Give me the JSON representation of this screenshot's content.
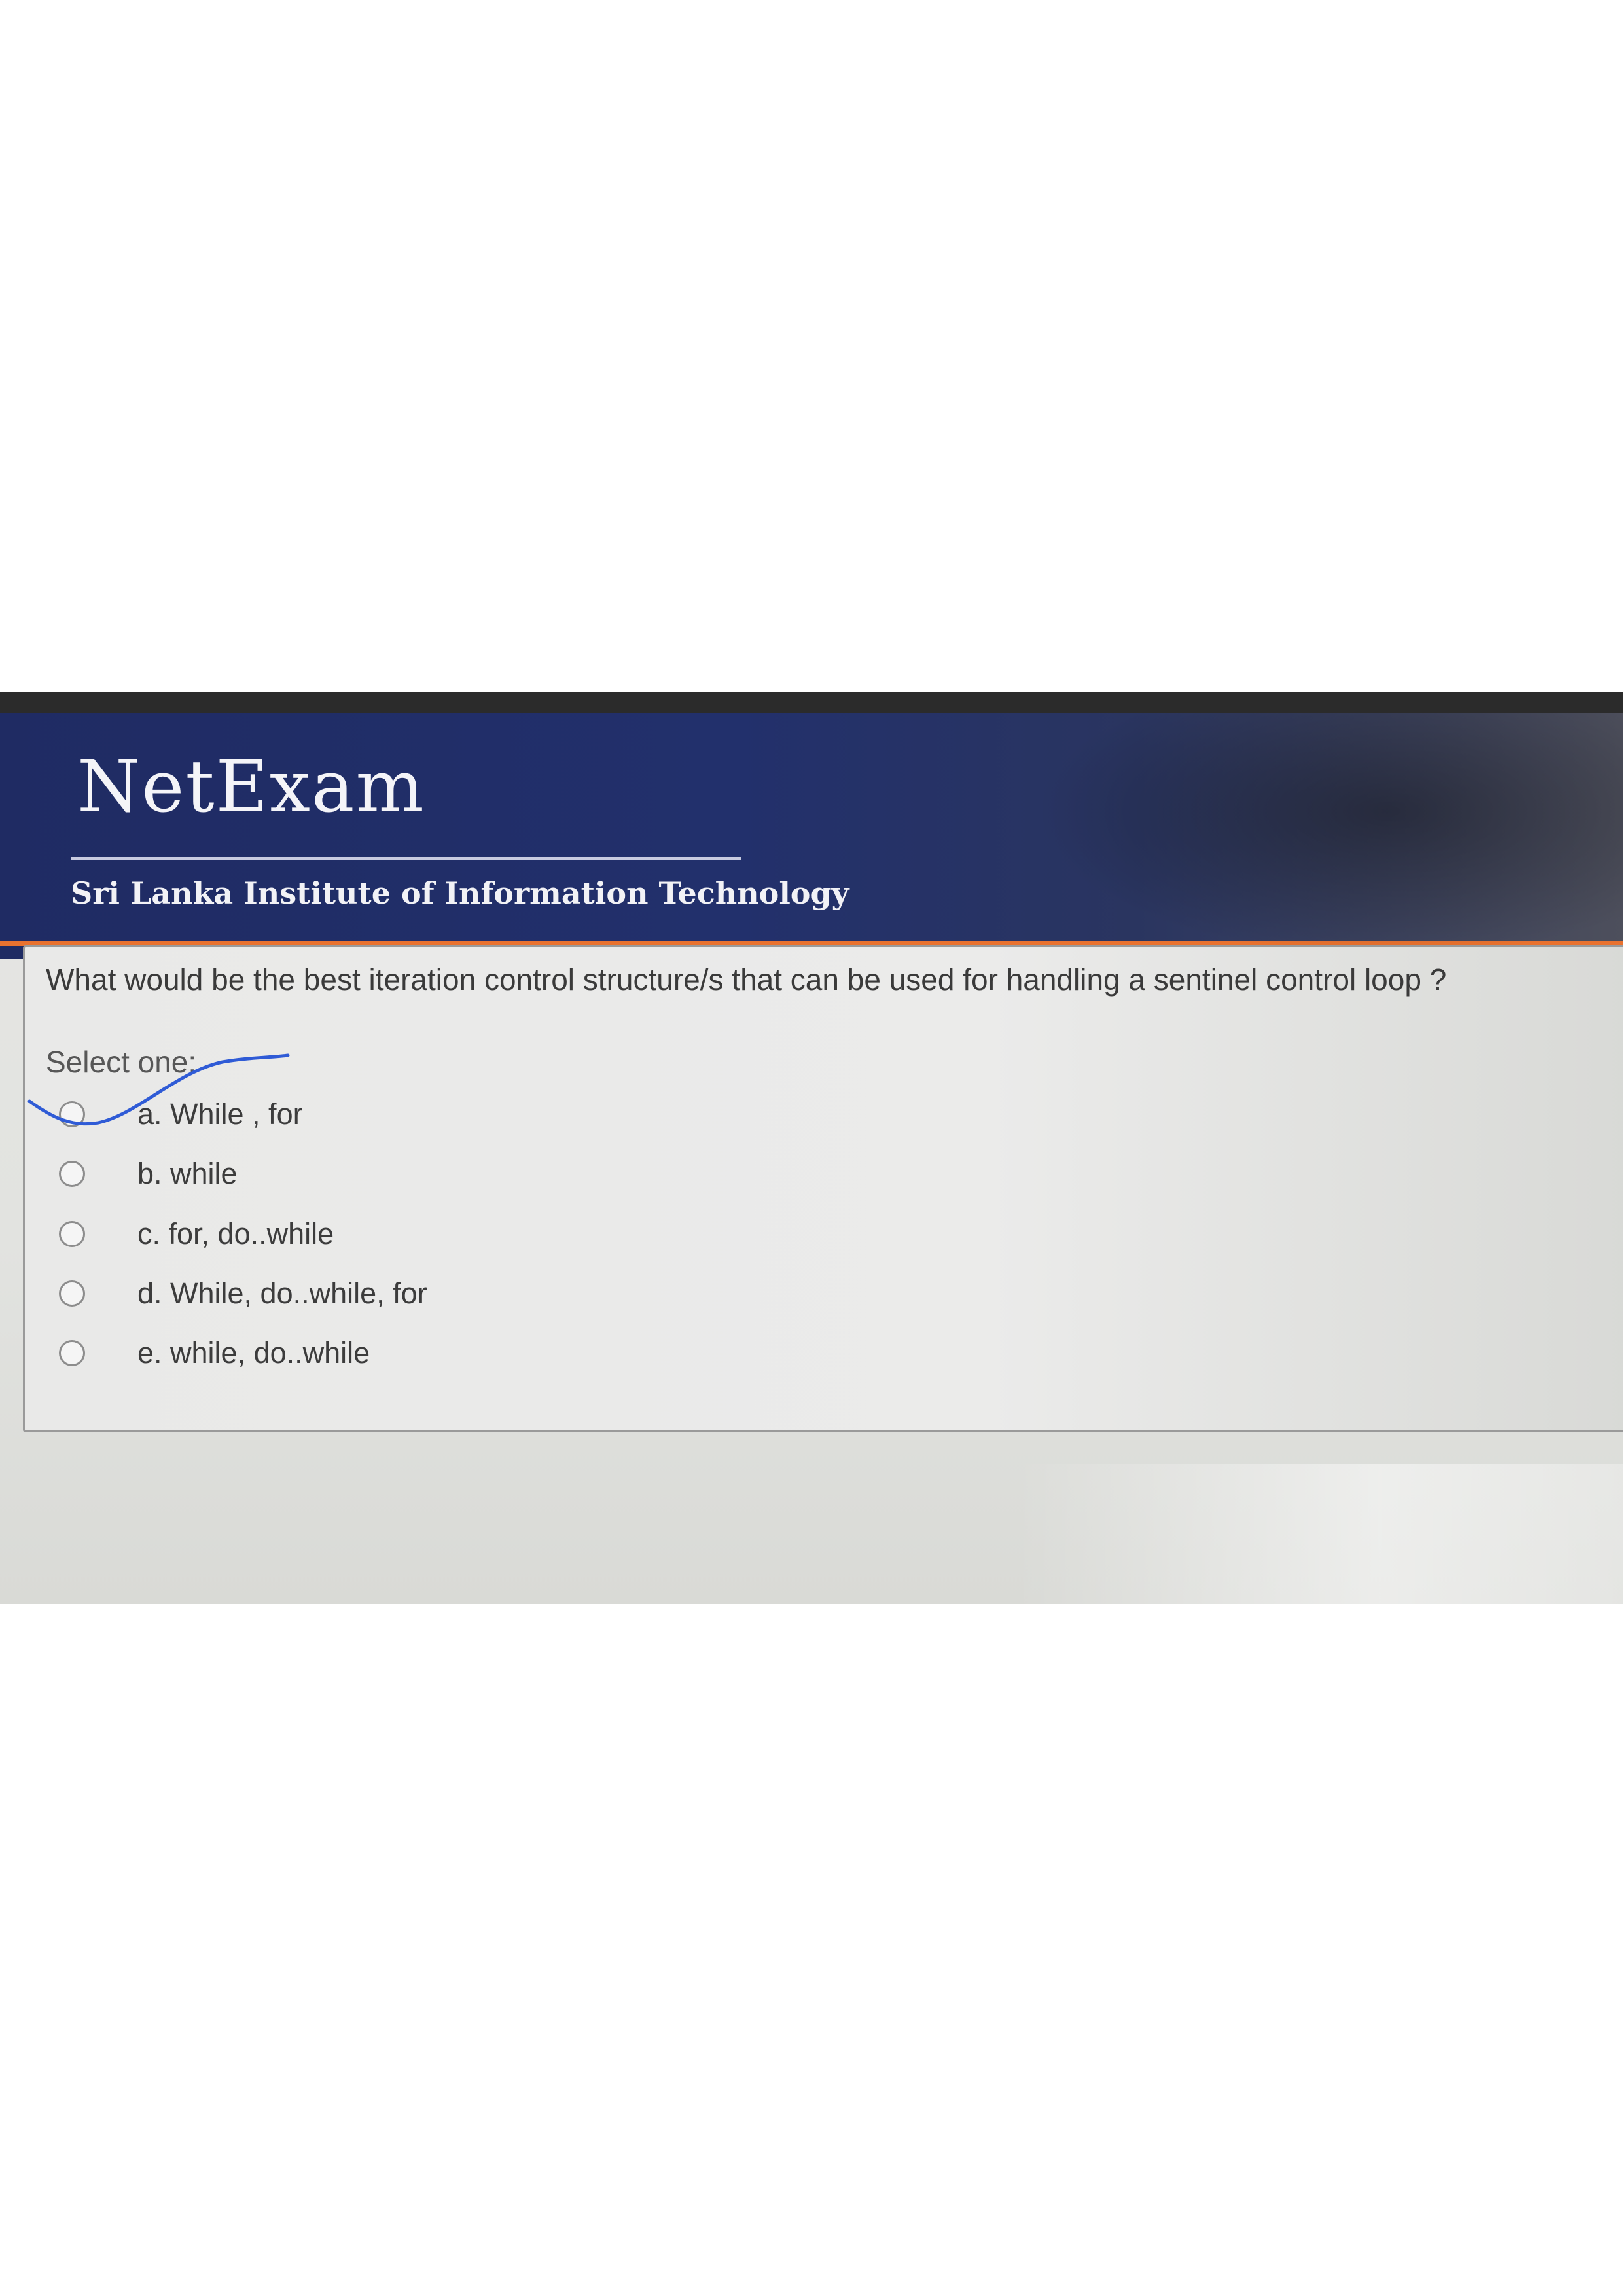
{
  "header": {
    "app_name": "NetExam",
    "institution": "Sri Lanka Institute of Information Technology"
  },
  "question": {
    "text": "What would be the best iteration control structure/s that can be used for handling a sentinel control loop ?",
    "select_label": "Select one:",
    "options": [
      {
        "label": "a. While , for"
      },
      {
        "label": "b. while"
      },
      {
        "label": "c. for, do..while"
      },
      {
        "label": "d. While, do..while, for"
      },
      {
        "label": "e. while, do..while"
      }
    ]
  },
  "colors": {
    "header_blue": "#22306c",
    "accent_orange": "#e9722f",
    "pen_blue": "#2f5bd6"
  }
}
